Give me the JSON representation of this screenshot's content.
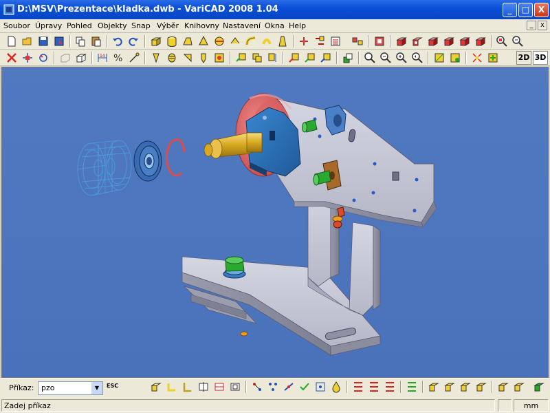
{
  "window": {
    "title": "D:\\MSV\\Prezentace\\kladka.dwb - VariCAD 2008 1.04",
    "minimize_label": "_",
    "maximize_label": "□",
    "close_label": "X"
  },
  "menu": {
    "items": [
      "Soubor",
      "Úpravy",
      "Pohled",
      "Objekty",
      "Snap",
      "Výběr",
      "Knihovny",
      "Nastavení",
      "Okna",
      "Help"
    ],
    "doc_minimize": "_",
    "doc_close": "x"
  },
  "toolbar2": {
    "mode_2d": "2D",
    "mode_3d": "3D"
  },
  "command": {
    "label": "Příkaz:",
    "value": "pzo",
    "esc_label": "ESC"
  },
  "status": {
    "prompt": "Zadej příkaz",
    "units": "mm"
  },
  "colors": {
    "viewport": "#5078c0",
    "plate": "#c2c4d2",
    "tire": "#e06060",
    "bracket": "#2a6db0",
    "shaft": "#d9b02a",
    "bolt_green": "#2aa830",
    "bearing_wire": "#4aa0e0"
  }
}
